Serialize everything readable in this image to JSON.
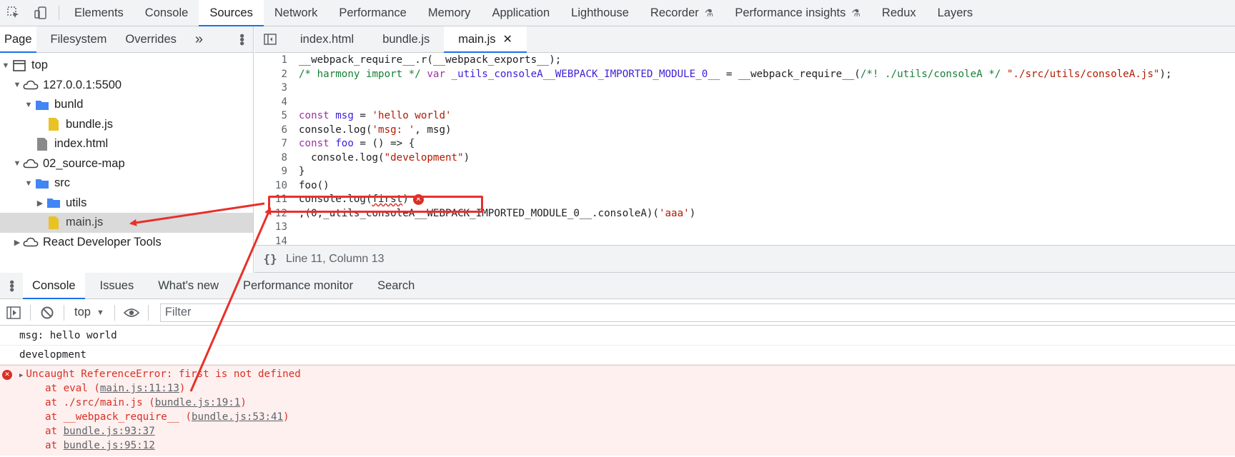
{
  "top_tabs": {
    "inspect_icon": "cursor-select-icon",
    "device_icon": "device-toggle-icon",
    "items": [
      {
        "label": "Elements"
      },
      {
        "label": "Console"
      },
      {
        "label": "Sources",
        "active": true
      },
      {
        "label": "Network"
      },
      {
        "label": "Performance"
      },
      {
        "label": "Memory"
      },
      {
        "label": "Application"
      },
      {
        "label": "Lighthouse"
      },
      {
        "label": "Recorder",
        "flask": true
      },
      {
        "label": "Performance insights",
        "flask": true
      },
      {
        "label": "Redux"
      },
      {
        "label": "Layers"
      }
    ]
  },
  "navigator": {
    "tabs": [
      {
        "label": "Page",
        "active": true
      },
      {
        "label": "Filesystem"
      },
      {
        "label": "Overrides"
      }
    ],
    "more": "»",
    "tree": [
      {
        "label": "top",
        "type": "frame",
        "depth": 0,
        "open": true
      },
      {
        "label": "127.0.0.1:5500",
        "type": "cloud",
        "depth": 1,
        "open": true
      },
      {
        "label": "bunld",
        "type": "folder",
        "depth": 2,
        "open": true
      },
      {
        "label": "bundle.js",
        "type": "js",
        "depth": 3
      },
      {
        "label": "index.html",
        "type": "html",
        "depth": 2
      },
      {
        "label": "02_source-map",
        "type": "cloud",
        "depth": 1,
        "open": true
      },
      {
        "label": "src",
        "type": "folder",
        "depth": 2,
        "open": true
      },
      {
        "label": "utils",
        "type": "folder",
        "depth": 3,
        "open": false
      },
      {
        "label": "main.js",
        "type": "js",
        "depth": 3,
        "selected": true
      },
      {
        "label": "React Developer Tools",
        "type": "cloud",
        "depth": 1,
        "open": false
      }
    ]
  },
  "editor": {
    "tabs": [
      {
        "label": "index.html"
      },
      {
        "label": "bundle.js"
      },
      {
        "label": "main.js",
        "active": true,
        "close": "✕"
      }
    ],
    "lines": [
      {
        "n": "1",
        "html": "__webpack_require__.r(__webpack_exports__);"
      },
      {
        "n": "2",
        "html": "<span class='c'>/* harmony import */ </span><span class='k'>var</span><span class='v'> _utils_consoleA__WEBPACK_IMPORTED_MODULE_0__</span> = __webpack_require__(<span class='c'>/*! ./utils/consoleA */</span> <span class='s'>\"./src/utils/consoleA.js\"</span>);"
      },
      {
        "n": "3",
        "html": ""
      },
      {
        "n": "4",
        "html": ""
      },
      {
        "n": "5",
        "html": "<span class='k'>const</span><span class='v'> msg</span> = <span class='s'>'hello world'</span>"
      },
      {
        "n": "6",
        "html": "console.log(<span class='s'>'msg: '</span>, msg)"
      },
      {
        "n": "7",
        "html": "<span class='k'>const</span><span class='v'> foo</span> = () =&gt; {"
      },
      {
        "n": "8",
        "html": "  console.log(<span class='s'>\"development\"</span>)"
      },
      {
        "n": "9",
        "html": "}"
      },
      {
        "n": "10",
        "html": "foo()"
      },
      {
        "n": "11",
        "html": "console.log(<span class='squig'>first</span>)<span class='errmark'>✕</span>"
      },
      {
        "n": "12",
        "html": ";(0,_utils_consoleA__WEBPACK_IMPORTED_MODULE_0__.consoleA)(<span class='s'>'aaa'</span>)"
      },
      {
        "n": "13",
        "html": ""
      },
      {
        "n": "14",
        "html": ""
      }
    ],
    "status": {
      "format_icon": "{}",
      "position": "Line 11, Column 13"
    }
  },
  "drawer": {
    "tabs": [
      {
        "label": "Console",
        "active": true
      },
      {
        "label": "Issues"
      },
      {
        "label": "What's new"
      },
      {
        "label": "Performance monitor"
      },
      {
        "label": "Search"
      }
    ],
    "context": "top",
    "filter_placeholder": "Filter"
  },
  "console": {
    "messages": [
      "msg:  hello world",
      "development"
    ],
    "error": {
      "title": "Uncaught ReferenceError: first is not defined",
      "frames": [
        {
          "prefix": "at eval (",
          "link": "main.js:11:13",
          "suffix": ")"
        },
        {
          "prefix": "at ./src/main.js (",
          "link": "bundle.js:19:1",
          "suffix": ")"
        },
        {
          "prefix": "at __webpack_require__ (",
          "link": "bundle.js:53:41",
          "suffix": ")"
        },
        {
          "prefix": "at ",
          "link": "bundle.js:93:37",
          "suffix": ""
        },
        {
          "prefix": "at ",
          "link": "bundle.js:95:12",
          "suffix": ""
        }
      ]
    }
  },
  "colors": {
    "accent": "#1a73e8",
    "error": "#d93025",
    "annotation": "#e8302a",
    "folder": "#4285f4",
    "js_file": "#e9c226"
  }
}
